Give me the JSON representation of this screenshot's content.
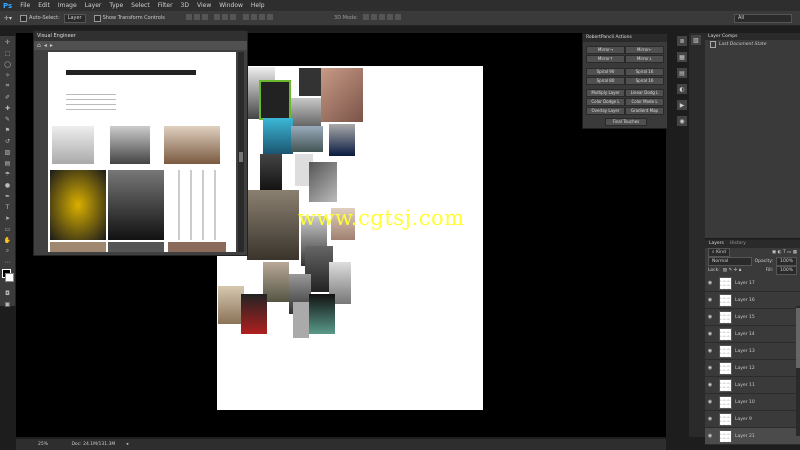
{
  "app": {
    "logo": "Ps"
  },
  "menu": [
    "File",
    "Edit",
    "Image",
    "Layer",
    "Type",
    "Select",
    "Filter",
    "3D",
    "View",
    "Window",
    "Help"
  ],
  "options_bar": {
    "auto_select_label": "Auto-Select:",
    "auto_select_value": "Layer",
    "transform_label": "Show Transform Controls",
    "mode_label": "3D Mode:",
    "workspace": "All"
  },
  "visual_engineer": {
    "title": "Visual Engineer"
  },
  "actions": {
    "title": "RobertPancli Actions",
    "buttons": [
      "Mirror→",
      "Mirror←",
      "Mirror↑",
      "Mirror↓",
      "Spiral 90",
      "Spiral 16",
      "Spiral 80",
      "Spiral 16",
      "Multiply Layer",
      "Linear Dodg L",
      "Color Dodge L",
      "Color Mode L",
      "Overlay Layer",
      "Gradient Map",
      "Final Touches"
    ]
  },
  "layer_comps": {
    "title": "Layer Comps",
    "item": "Last Document State"
  },
  "layers": {
    "tabs": [
      "Layers",
      "History"
    ],
    "filter": "Kind",
    "blend": "Normal",
    "opacity_label": "Opacity:",
    "opacity": "100%",
    "lock_label": "Lock:",
    "fill_label": "Fill:",
    "fill": "100%",
    "items": [
      "Layer 17",
      "Layer 16",
      "Layer 15",
      "Layer 14",
      "Layer 13",
      "Layer 12",
      "Layer 11",
      "Layer 10",
      "Layer 9",
      "Layer 21"
    ]
  },
  "status": {
    "zoom": "25%",
    "doc": "Doc: 24.1M/131.3M"
  },
  "watermark": "www.cgtsj.com"
}
